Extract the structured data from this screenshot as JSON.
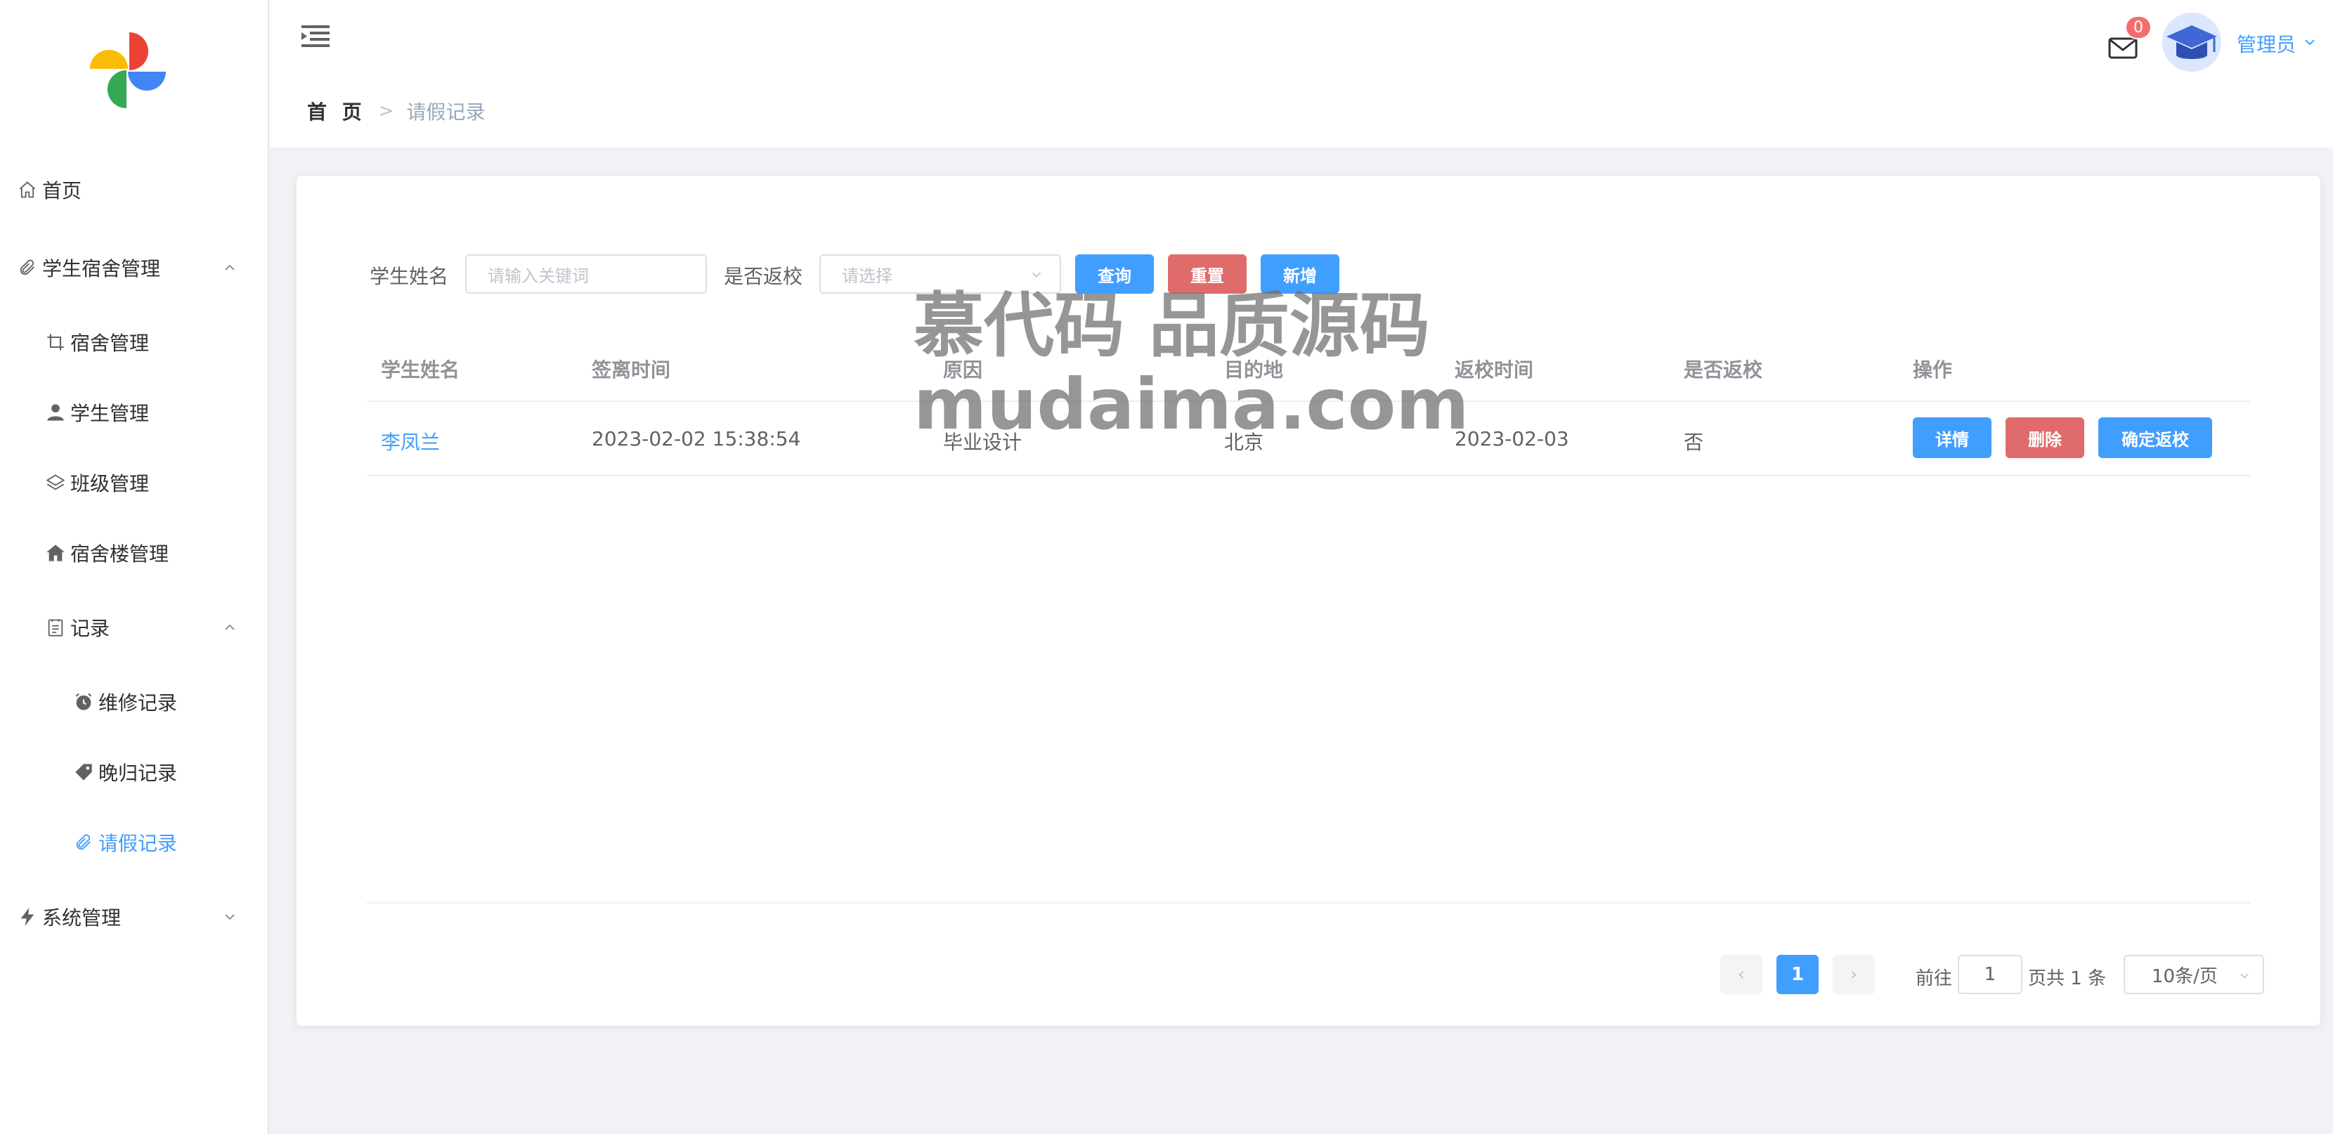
{
  "sidebar": {
    "logo": "pinwheel-logo",
    "items": [
      {
        "label": "首页",
        "icon": "home-icon"
      },
      {
        "label": "学生宿舍管理",
        "icon": "paperclip-icon"
      },
      {
        "label": "宿舍管理",
        "icon": "crop-icon"
      },
      {
        "label": "学生管理",
        "icon": "user-icon"
      },
      {
        "label": "班级管理",
        "icon": "layers-icon"
      },
      {
        "label": "宿舍楼管理",
        "icon": "house-icon"
      },
      {
        "label": "记录",
        "icon": "document-icon"
      },
      {
        "label": "维修记录",
        "icon": "alarm-clock-icon"
      },
      {
        "label": "晚归记录",
        "icon": "tag-icon"
      },
      {
        "label": "请假记录",
        "icon": "paperclip-icon"
      },
      {
        "label": "系统管理",
        "icon": "lightning-icon"
      }
    ]
  },
  "header": {
    "breadcrumb_home": "首 页",
    "breadcrumb_separator": ">",
    "breadcrumb_current": "请假记录",
    "badge_count": "0",
    "username": "管理员"
  },
  "filters": {
    "name_label": "学生姓名",
    "name_placeholder": "请输入关键词",
    "return_label": "是否返校",
    "return_placeholder": "请选择",
    "query_button": "查询",
    "reset_button": "重置",
    "add_button": "新增"
  },
  "table": {
    "headers": [
      "学生姓名",
      "签离时间",
      "原因",
      "目的地",
      "返校时间",
      "是否返校",
      "操作"
    ],
    "rows": [
      {
        "name": "李凤兰",
        "leave_time": "2023-02-02 15:38:54",
        "reason": "毕业设计",
        "destination": "北京",
        "return_time": "2023-02-03",
        "returned": "否",
        "detail_button": "详情",
        "delete_button": "删除",
        "confirm_button": "确定返校"
      }
    ]
  },
  "watermark": {
    "line1": "慕代码 品质源码",
    "line2": "mudaima.com"
  },
  "pagination": {
    "prev": "‹",
    "page": "1",
    "next": "›",
    "goto_label": "前往",
    "goto_value": "1",
    "total_text": "页共 1 条",
    "page_size": "10条/页"
  },
  "colors": {
    "primary": "#409eff",
    "danger": "#e06b6b",
    "badge": "#f56c6c"
  }
}
